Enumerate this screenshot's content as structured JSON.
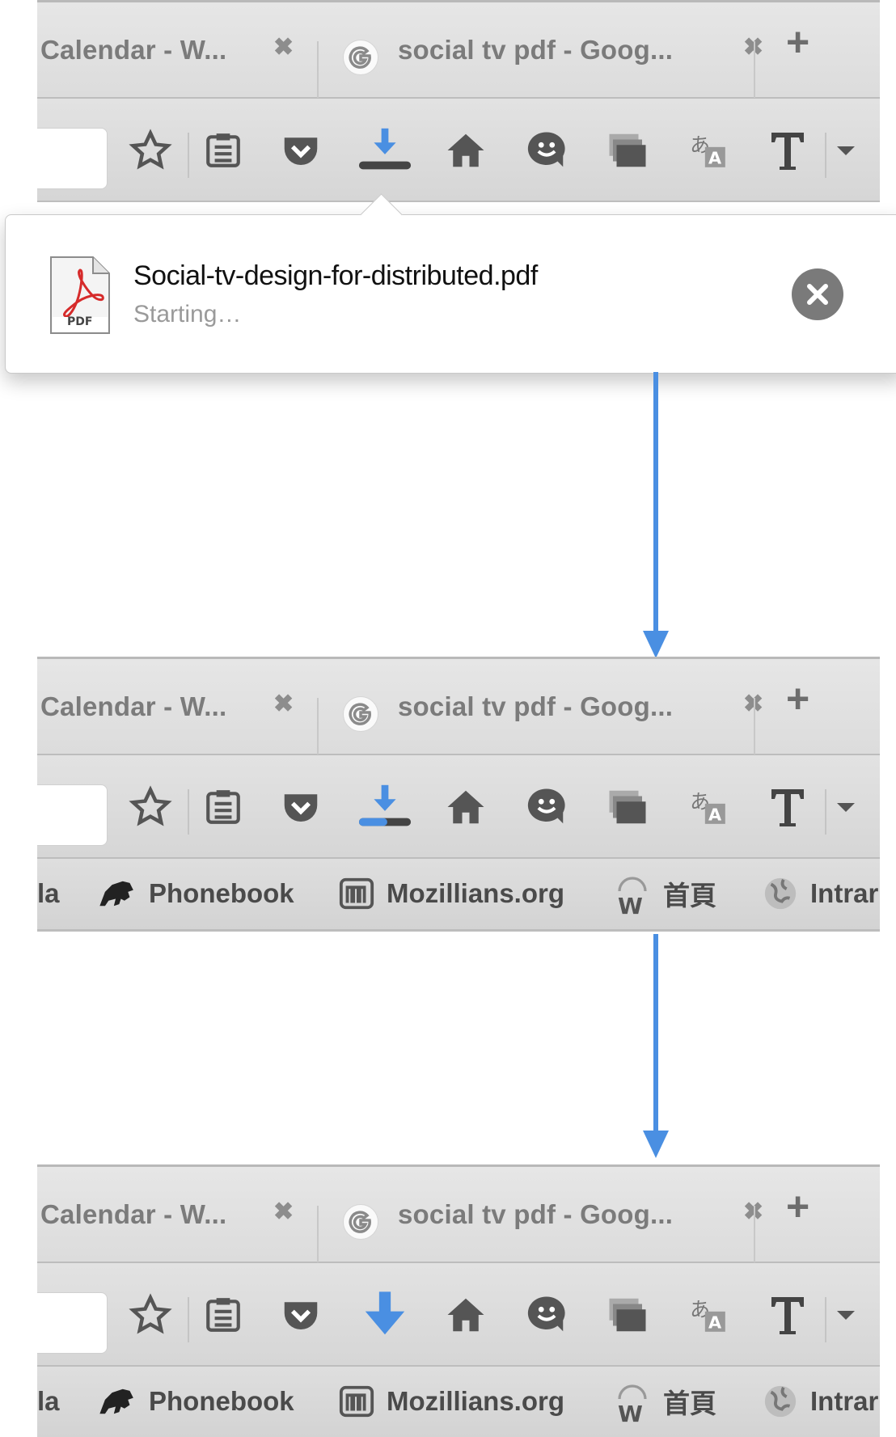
{
  "colors": {
    "accent_blue": "#4a8fe2",
    "toolbar_gray": "#d9d9d9",
    "icon_gray": "#555555",
    "pdf_red": "#d62b2b"
  },
  "browser": {
    "tabs": [
      {
        "title": "Calendar - W...",
        "close_icon": "close-icon"
      },
      {
        "title": "social tv pdf - Goog...",
        "favicon": "google-g-icon",
        "close_icon": "close-icon"
      }
    ],
    "new_tab_icon": "plus-icon",
    "toolbar_icons": [
      "star-icon",
      "reading-list-icon",
      "pocket-icon",
      "download-icon",
      "home-icon",
      "smiley-icon",
      "window-stack-icon",
      "translate-icon",
      "text-size-icon",
      "overflow-chevron-icon"
    ],
    "bookmarks": [
      {
        "label": "la"
      },
      {
        "label": "Phonebook",
        "icon": "dino-icon"
      },
      {
        "label": "Mozillians.org",
        "icon": "m-logo-icon"
      },
      {
        "label": "首頁",
        "icon": "w-logo-icon"
      },
      {
        "label": "Intrar",
        "icon": "globe-icon"
      }
    ]
  },
  "download_panel": {
    "file_name": "Social-tv-design-for-distributed.pdf",
    "status": "Starting…",
    "file_icon_label": "PDF",
    "cancel_icon": "close-circle-icon"
  },
  "states": [
    {
      "download_icon_state": "in-progress-with-empty-bar",
      "progress": 0.0
    },
    {
      "download_icon_state": "in-progress-with-bar",
      "progress": 0.55
    },
    {
      "download_icon_state": "complete-arrow-only",
      "progress": 1.0
    }
  ]
}
